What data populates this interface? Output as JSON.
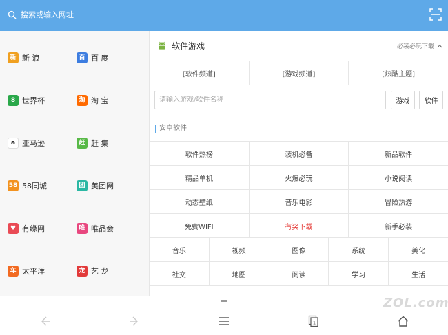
{
  "search": {
    "placeholder": "搜索或输入网址"
  },
  "sites": [
    {
      "name": "新 浪",
      "logo": "新",
      "color": "#f0a020"
    },
    {
      "name": "百 度",
      "logo": "百",
      "color": "#3d7de0"
    },
    {
      "name": "世界杯",
      "logo": "8",
      "color": "#2aa84a"
    },
    {
      "name": "淘 宝",
      "logo": "淘",
      "color": "#ff6a00"
    },
    {
      "name": "亚马逊",
      "logo": "a",
      "color": "#ffffff"
    },
    {
      "name": "赶 集",
      "logo": "赶",
      "color": "#58b947"
    },
    {
      "name": "58同城",
      "logo": "58",
      "color": "#f39320"
    },
    {
      "name": "美团网",
      "logo": "团",
      "color": "#2cb8a4"
    },
    {
      "name": "有缘网",
      "logo": "♥",
      "color": "#e94b55"
    },
    {
      "name": "唯品会",
      "logo": "唯",
      "color": "#e8477f"
    },
    {
      "name": "太平洋",
      "logo": "车",
      "color": "#f26a21"
    },
    {
      "name": "艺 龙",
      "logo": "龙",
      "color": "#e23a3a"
    }
  ],
  "section": {
    "title": "软件游戏",
    "more": "必装必玩下载",
    "channels": [
      "[软件频道]",
      "[游戏频道]",
      "[炫酷主题]"
    ],
    "search_placeholder": "请输入游戏/软件名称",
    "btn_game": "游戏",
    "btn_software": "软件",
    "category": "安卓软件",
    "grid": [
      [
        "软件热榜",
        "装机必备",
        "新品软件"
      ],
      [
        "精品单机",
        "火爆必玩",
        "小说阅读"
      ],
      [
        "动态壁纸",
        "音乐电影",
        "冒险热游"
      ],
      [
        "免费WIFI",
        "有奖下载",
        "新手必装"
      ]
    ],
    "hot_cell": "有奖下载",
    "tags": [
      [
        "音乐",
        "视频",
        "图像",
        "系统",
        "美化"
      ],
      [
        "社交",
        "地图",
        "阅读",
        "学习",
        "生活"
      ]
    ]
  },
  "toolbar": {
    "back": "back-icon",
    "forward": "forward-icon",
    "menu": "menu-icon",
    "tabs_count": "1",
    "home": "home-icon"
  },
  "watermark": "ZOL.com"
}
